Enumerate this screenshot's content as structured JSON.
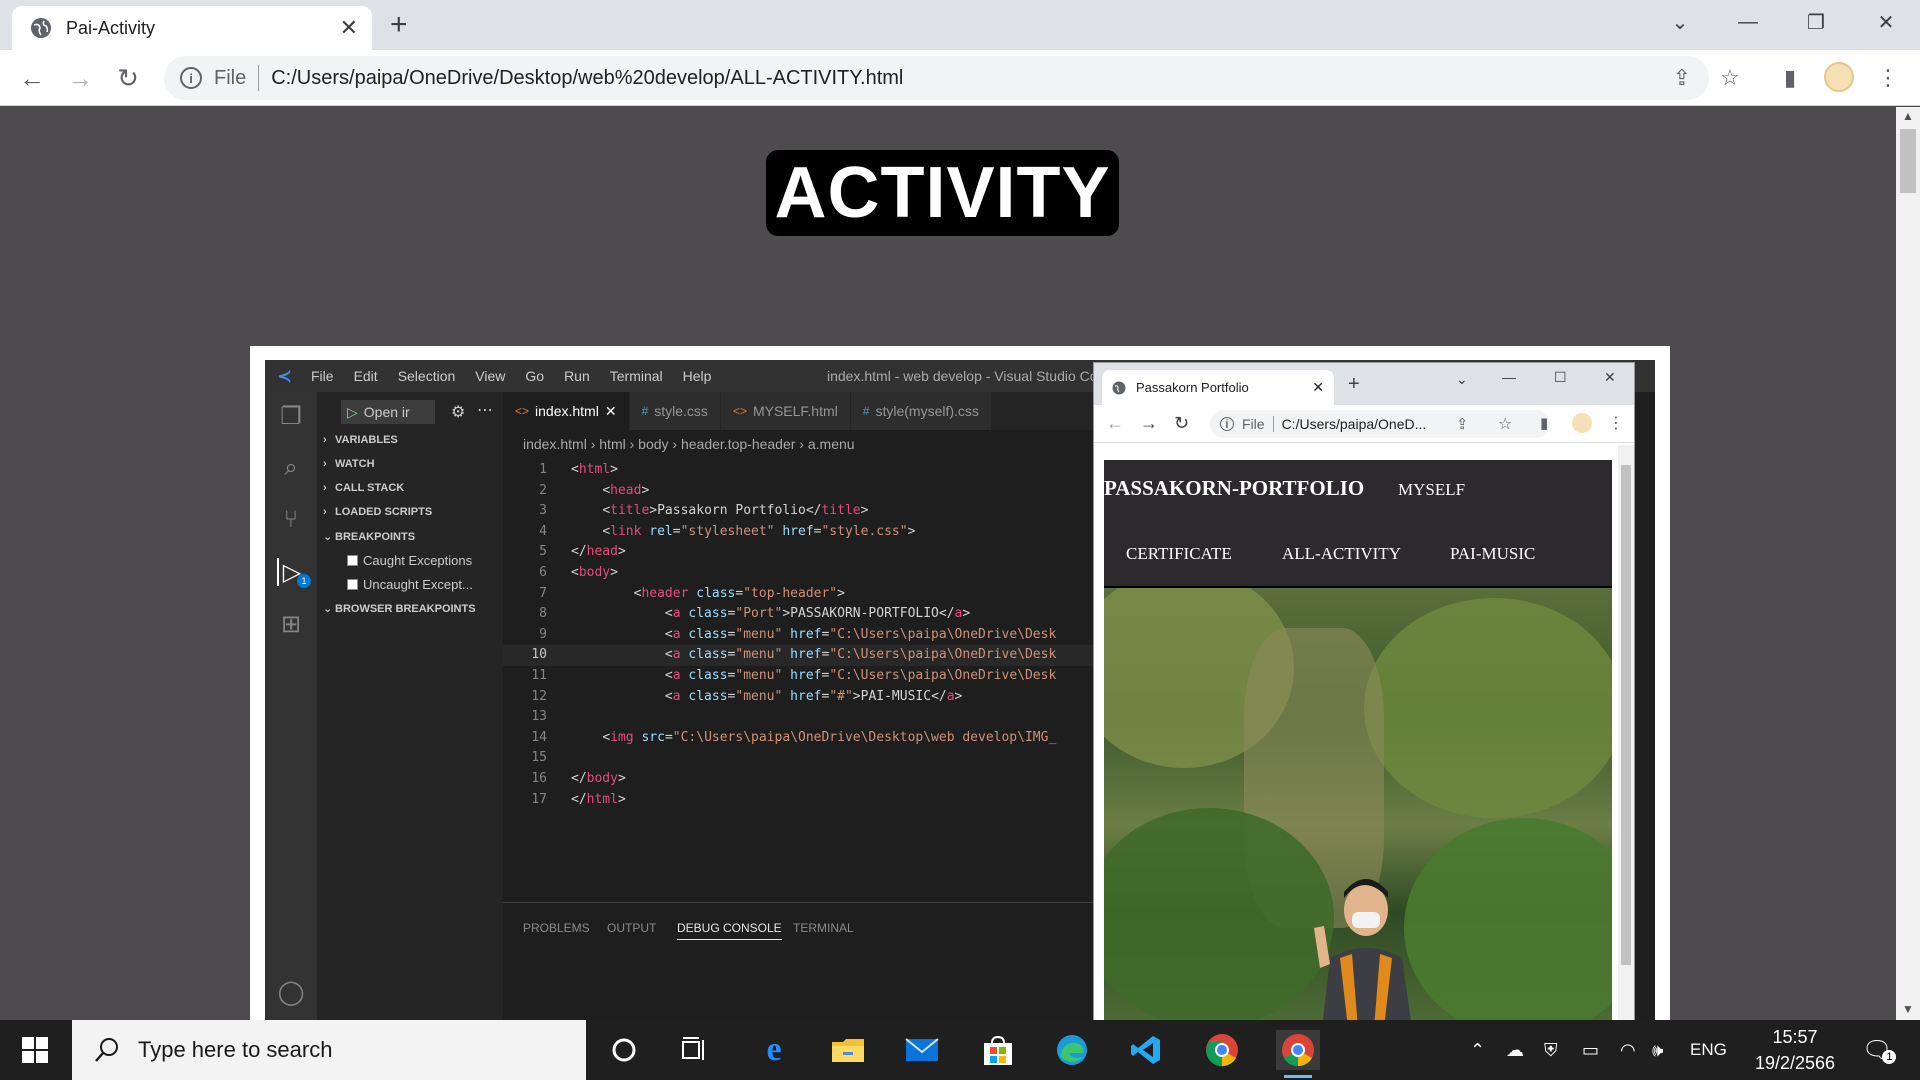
{
  "browser": {
    "tab_title": "Pai-Activity",
    "address_scheme": "File",
    "address_url": "C:/Users/paipa/OneDrive/Desktop/web%20develop/ALL-ACTIVITY.html"
  },
  "page": {
    "heading": "ACTIVITY"
  },
  "vscode": {
    "menu": [
      "File",
      "Edit",
      "Selection",
      "View",
      "Go",
      "Run",
      "Terminal",
      "Help"
    ],
    "window_title": "index.html - web develop - Visual Studio Code",
    "debug_button": "Open ir",
    "sections": {
      "variables": "VARIABLES",
      "watch": "WATCH",
      "call_stack": "CALL STACK",
      "loaded_scripts": "LOADED SCRIPTS",
      "breakpoints": "BREAKPOINTS",
      "caught": "Caught Exceptions",
      "uncaught": "Uncaught Except...",
      "browser_breakpoints": "BROWSER BREAKPOINTS"
    },
    "tabs": [
      "index.html",
      "style.css",
      "MYSELF.html",
      "style(myself).css"
    ],
    "breadcrumb": [
      "index.html",
      "html",
      "body",
      "header.top-header",
      "a.menu"
    ],
    "debug_badge": "1",
    "panel_tabs": [
      "PROBLEMS",
      "OUTPUT",
      "DEBUG CONSOLE",
      "TERMINAL"
    ]
  },
  "inner_browser": {
    "tab_title": "Passakorn Portfolio",
    "address_scheme": "File",
    "address_url": "C:/Users/paipa/OneD...",
    "site": {
      "port": "PASSAKORN-PORTFOLIO",
      "menu": [
        "MYSELF",
        "CERTIFICATE",
        "ALL-ACTIVITY",
        "PAI-MUSIC"
      ]
    }
  },
  "taskbar": {
    "search_placeholder": "Type here to search",
    "language": "ENG",
    "time": "15:57",
    "date": "19/2/2566",
    "notification_count": "1"
  },
  "colors": {
    "page_bg": "#4d4b4d",
    "heading_bg": "#000000",
    "vscode_bg": "#1e1e1e",
    "site_header_bg": "#2c2a2c"
  }
}
